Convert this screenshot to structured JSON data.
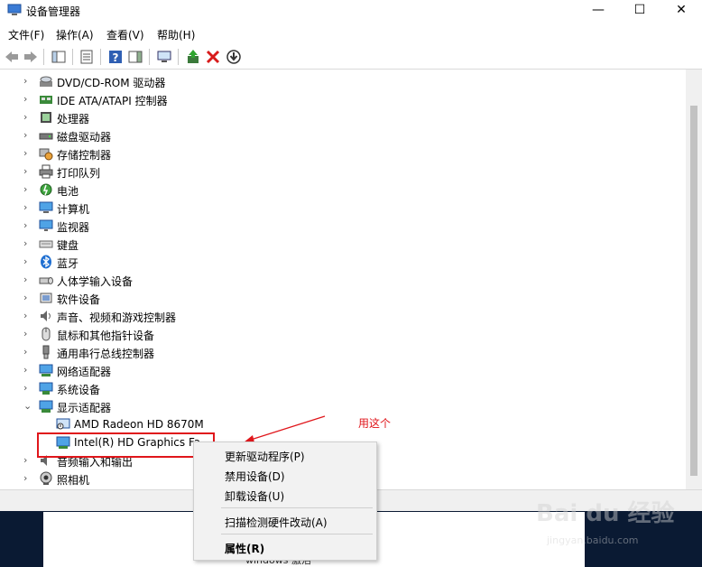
{
  "window": {
    "title": "设备管理器",
    "minimize_glyph": "—",
    "maximize_glyph": "☐",
    "close_glyph": "✕"
  },
  "menu": [
    "文件(F)",
    "操作(A)",
    "查看(V)",
    "帮助(H)"
  ],
  "tree": {
    "items": [
      {
        "label": "DVD/CD-ROM 驱动器",
        "icon": "dvd-drive-icon",
        "expanded": false
      },
      {
        "label": "IDE ATA/ATAPI 控制器",
        "icon": "ide-controller-icon",
        "expanded": false
      },
      {
        "label": "处理器",
        "icon": "processor-icon",
        "expanded": false
      },
      {
        "label": "磁盘驱动器",
        "icon": "disk-drive-icon",
        "expanded": false
      },
      {
        "label": "存储控制器",
        "icon": "storage-controller-icon",
        "expanded": false
      },
      {
        "label": "打印队列",
        "icon": "printer-icon",
        "expanded": false
      },
      {
        "label": "电池",
        "icon": "battery-icon",
        "expanded": false
      },
      {
        "label": "计算机",
        "icon": "computer-icon",
        "expanded": false
      },
      {
        "label": "监视器",
        "icon": "monitor-icon",
        "expanded": false
      },
      {
        "label": "键盘",
        "icon": "keyboard-icon",
        "expanded": false
      },
      {
        "label": "蓝牙",
        "icon": "bluetooth-icon",
        "expanded": false
      },
      {
        "label": "人体学输入设备",
        "icon": "hid-icon",
        "expanded": false
      },
      {
        "label": "软件设备",
        "icon": "software-device-icon",
        "expanded": false
      },
      {
        "label": "声音、视频和游戏控制器",
        "icon": "sound-icon",
        "expanded": false
      },
      {
        "label": "鼠标和其他指针设备",
        "icon": "mouse-icon",
        "expanded": false
      },
      {
        "label": "通用串行总线控制器",
        "icon": "usb-icon",
        "expanded": false
      },
      {
        "label": "网络适配器",
        "icon": "network-adapter-icon",
        "expanded": false
      },
      {
        "label": "系统设备",
        "icon": "system-device-icon",
        "expanded": false
      },
      {
        "label": "显示适配器",
        "icon": "display-adapter-icon",
        "expanded": true
      }
    ],
    "display_children": [
      "AMD Radeon HD 8670M",
      "Intel(R) HD Graphics Fa"
    ],
    "after_items": [
      {
        "label": "音频输入和输出",
        "icon": "audio-io-icon"
      },
      {
        "label": "照相机",
        "icon": "camera-icon"
      }
    ]
  },
  "context_menu": {
    "items": [
      "更新驱动程序(P)",
      "禁用设备(D)",
      "卸载设备(U)",
      "扫描检测硬件改动(A)",
      "属性(R)"
    ]
  },
  "annotation": "用这个",
  "watermark": {
    "brand": "Bai du 经验",
    "url": "jingyan.baidu.com"
  },
  "bottom_text": "windows 激活",
  "colors": {
    "accent": "#e0161b",
    "selection": "#cce8ff"
  }
}
